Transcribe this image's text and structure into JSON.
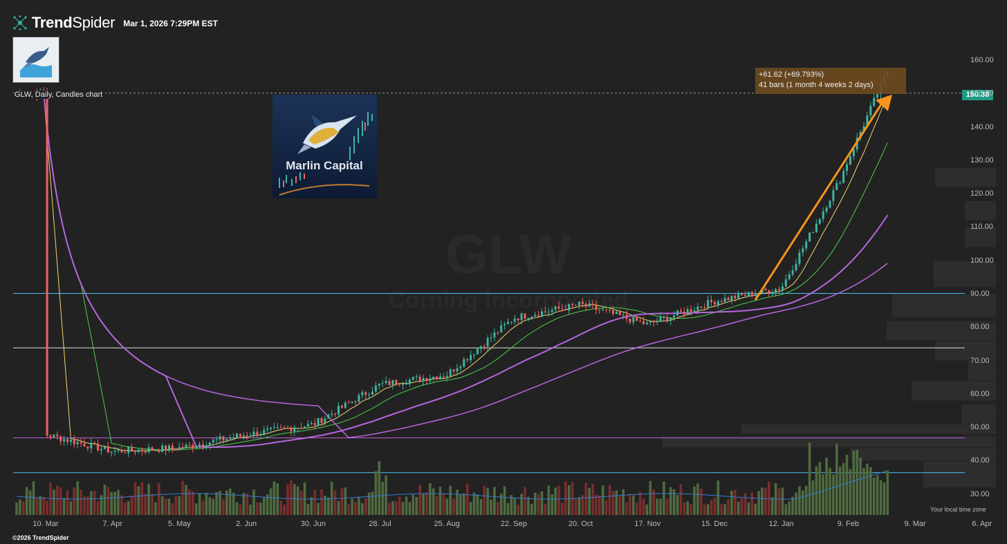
{
  "header": {
    "brand_bold": "Trend",
    "brand_light": "Spider",
    "timestamp": "Mar 1, 2026 7:29PM EST",
    "brand_color": "#2bb39b"
  },
  "chart_info": {
    "label": "GLW, Daily, Candles chart",
    "current_price": "150.38",
    "ticker_watermark": "GLW",
    "company_watermark": "Corning Incorporated",
    "timezone": "Your local time zone",
    "copyright": "©2026 TrendSpider"
  },
  "watermark_logo": {
    "text": "Marlin Capital"
  },
  "measure": {
    "line1": "+61.62 (+69.793%)",
    "line2": "41 bars (1 month 4 weeks 2 days)"
  },
  "chart_data": {
    "type": "line",
    "ylim": [
      22,
      165
    ],
    "y_ticks": [
      30,
      40,
      50,
      60,
      70,
      80,
      90,
      100,
      110,
      120,
      130,
      140,
      150,
      160
    ],
    "x_ticks": [
      "10. Mar",
      "7. Apr",
      "5. May",
      "2. Jun",
      "30. Jun",
      "28. Jul",
      "25. Aug",
      "22. Sep",
      "20. Oct",
      "17. Nov",
      "15. Dec",
      "12. Jan",
      "9. Feb",
      "9. Mar",
      "6. Apr"
    ],
    "horizontal_levels": [
      {
        "value": 90.3,
        "color": "#4fc3f7"
      },
      {
        "value": 74.0,
        "color": "#e0e0e0"
      },
      {
        "value": 47.0,
        "color": "#c15fd8"
      },
      {
        "value": 36.6,
        "color": "#4fc3f7"
      }
    ],
    "price_path": [
      [
        "10. Mar",
        48
      ],
      [
        "7. Apr",
        43
      ],
      [
        "5. May",
        44
      ],
      [
        "2. Jun",
        48
      ],
      [
        "30. Jun",
        51
      ],
      [
        "28. Jul",
        63
      ],
      [
        "25. Aug",
        66
      ],
      [
        "22. Sep",
        83
      ],
      [
        "20. Oct",
        87
      ],
      [
        "17. Nov",
        81
      ],
      [
        "15. Dec",
        88
      ],
      [
        "12. Jan",
        92
      ],
      [
        "9. Feb",
        129
      ],
      [
        "last",
        150.38
      ]
    ],
    "measure_arrow": {
      "from": 88.3,
      "to": 149.9
    },
    "colors": {
      "up": "#3fb5a2",
      "down": "#f0625f",
      "ema_fast": "#f5d76e",
      "ema_mid": "#4dd14d",
      "ma_slow": "#b866e0",
      "arrow": "#f7941d",
      "volume_up": "#4f6b3f",
      "volume_down": "#7a2d2d",
      "volume_avg": "#3a7bd5"
    }
  }
}
